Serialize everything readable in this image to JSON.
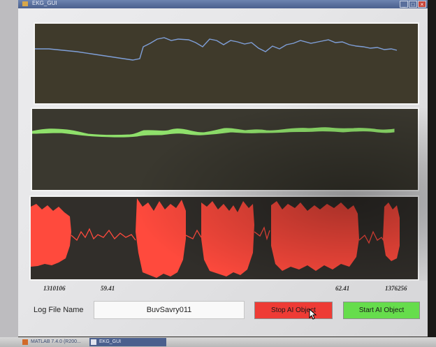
{
  "window": {
    "title": "EKG_GUI"
  },
  "window_controls": {
    "minimize": "_",
    "maximize": "□",
    "close": "×"
  },
  "axes": {
    "x_ticks": [
      "1310106",
      "59.41",
      "62.41",
      "1376256"
    ],
    "trace_colors": {
      "top": "#7f9fd8",
      "middle": "#8fe06b",
      "bottom": "#ff4a3d"
    }
  },
  "controls": {
    "log_label": "Log File Name",
    "log_value": "BuvSavry011",
    "stop_label": "Stop AI Object",
    "start_label": "Start AI Object"
  },
  "taskbar": {
    "items": [
      "MATLAB 7.4.0 (R200...",
      "EKG_GUI"
    ]
  },
  "colors": {
    "stop_button": "#ee3b35",
    "start_button": "#66dd4c",
    "titlebar": "#4a5f8d"
  },
  "icons": [
    "app-icon",
    "cursor-icon",
    "matlab-icon",
    "figure-icon"
  ]
}
